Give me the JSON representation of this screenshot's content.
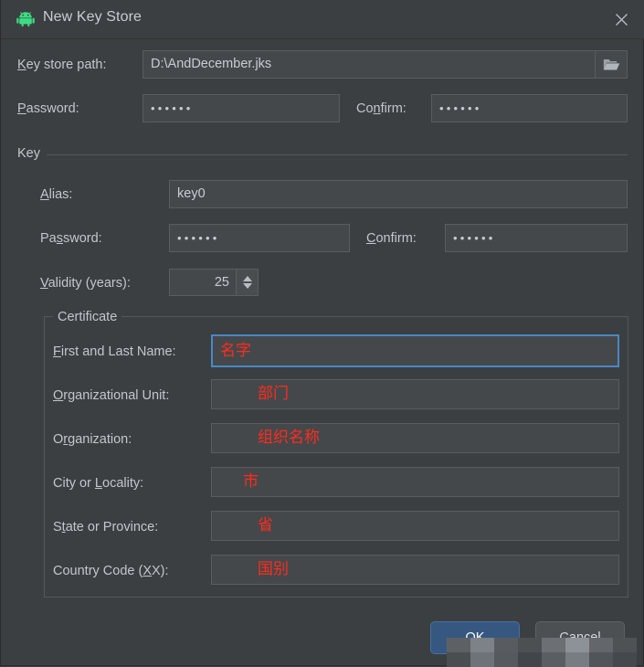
{
  "window": {
    "title": "New Key Store",
    "app_icon": "android-robot-icon",
    "close_icon": "close-icon"
  },
  "keystore": {
    "path_label": "Key store path:",
    "path_label_mnemonic": "K",
    "path_value": "D:\\AndDecember.jks",
    "browse_icon": "folder-open-icon",
    "password_label": "Password:",
    "password_label_mnemonic": "P",
    "password_value": "••••••",
    "confirm_label": "Confirm:",
    "confirm_label_mnemonic": "n",
    "confirm_value": "••••••"
  },
  "key_group": {
    "title": "Key",
    "alias_label": "Alias:",
    "alias_label_mnemonic": "A",
    "alias_value": "key0",
    "password_label": "Password:",
    "password_label_mnemonic": "s",
    "password_value": "••••••",
    "confirm_label": "Confirm:",
    "confirm_label_mnemonic": "C",
    "confirm_value": "••••••",
    "validity_label": "Validity (years):",
    "validity_label_mnemonic": "V",
    "validity_value": "25",
    "spinner_up_icon": "triangle-up-icon",
    "spinner_down_icon": "triangle-down-icon"
  },
  "certificate": {
    "title": "Certificate",
    "rows": [
      {
        "label": "First and Last Name:",
        "mnemonic": "F",
        "value": "名字",
        "focused": true
      },
      {
        "label": "Organizational Unit:",
        "mnemonic": "O",
        "value": "部门",
        "focused": false
      },
      {
        "label": "Organization:",
        "mnemonic": "r",
        "value": "组织名称",
        "focused": false
      },
      {
        "label": "City or Locality:",
        "mnemonic": "L",
        "value": "市",
        "focused": false
      },
      {
        "label": "State or Province:",
        "mnemonic": "t",
        "value": "省",
        "focused": false
      },
      {
        "label": "Country Code (XX):",
        "mnemonic": "X",
        "value": "国别",
        "focused": false
      }
    ]
  },
  "footer": {
    "ok_label": "OK",
    "cancel_label": "Cancel"
  },
  "colors": {
    "dialog_background": "#3c3f41",
    "field_background": "#45484a",
    "field_border": "#5a5d5f",
    "focus_border": "#4a88c7",
    "text": "#c2c7cc",
    "cjk_value_text": "#ff2b1e",
    "android_green": "#3ddc84",
    "ok_button": "#365880"
  }
}
